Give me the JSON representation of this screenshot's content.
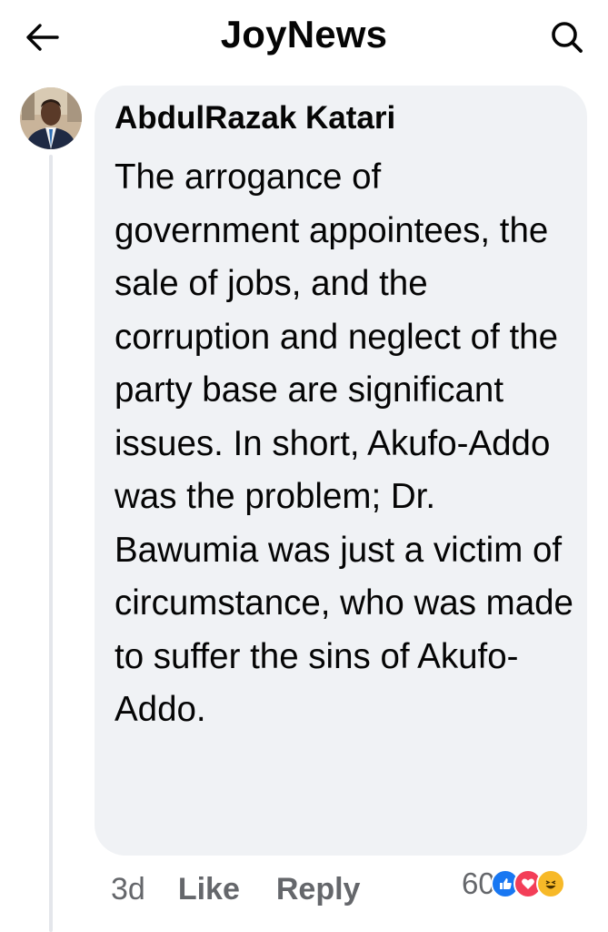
{
  "header": {
    "title": "JoyNews",
    "back_icon": "arrow-left-icon",
    "search_icon": "search-icon"
  },
  "comment": {
    "author": "AbdulRazak Katari",
    "avatar_icon": "profile-photo",
    "text": "The arrogance of government appointees, the sale of jobs, and the corruption and neglect of the party base are significant issues. In short, Akufo-Addo was the problem; Dr. Bawumia was just a victim of circumstance, who was made to suffer the sins of Akufo-Addo.",
    "time": "3d",
    "like_label": "Like",
    "reply_label": "Reply",
    "reaction_count": "60",
    "reactions": [
      "like-icon",
      "love-icon",
      "haha-icon"
    ]
  },
  "colors": {
    "bubble": "#f0f2f5",
    "secondary_text": "#65676b",
    "like_blue": "#1877f2",
    "love_red": "#f33e58",
    "haha_yellow": "#f7b928"
  }
}
